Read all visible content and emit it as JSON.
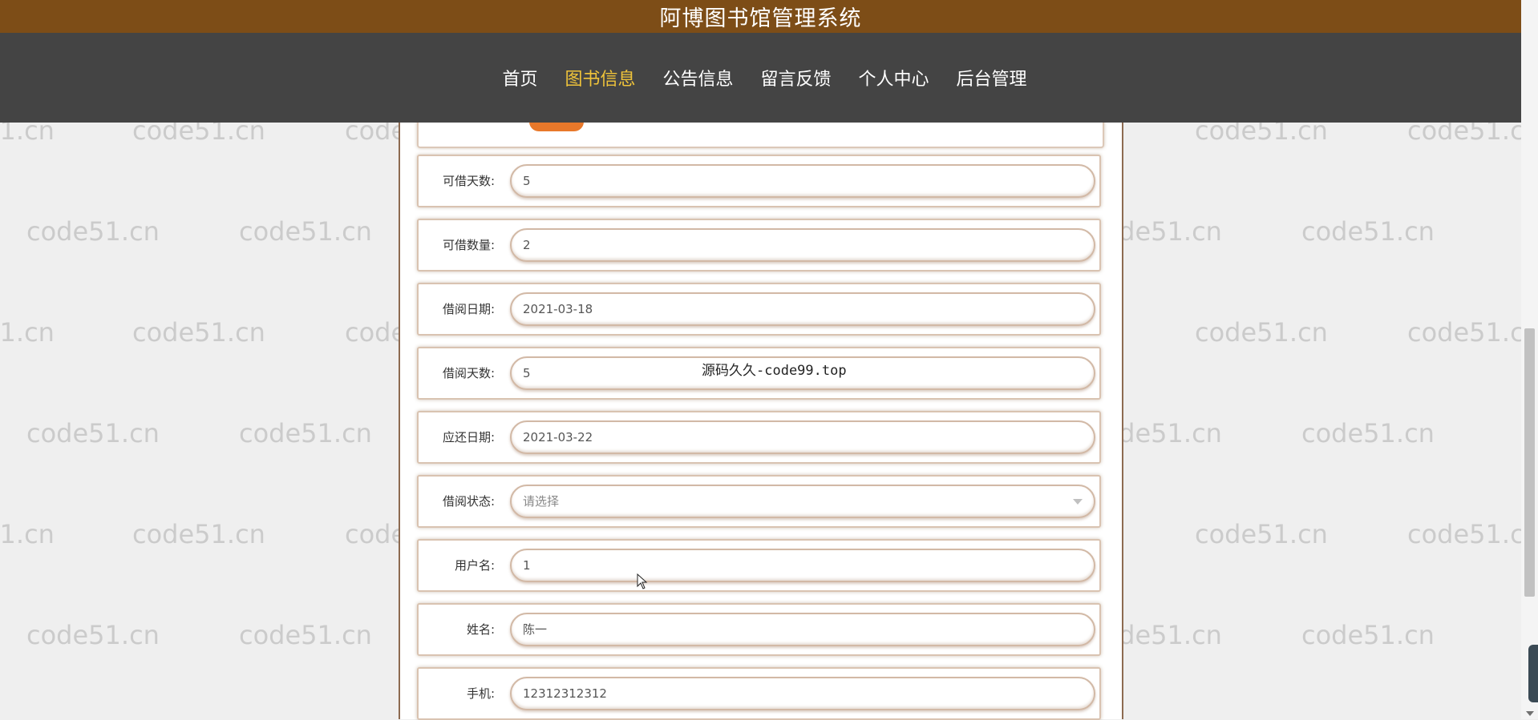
{
  "header": {
    "site_title": "阿博图书馆管理系统"
  },
  "nav": {
    "items": [
      "首页",
      "图书信息",
      "公告信息",
      "留言反馈",
      "个人中心",
      "后台管理"
    ],
    "active": "图书信息"
  },
  "form": {
    "fields": [
      {
        "label": "可借天数:",
        "value": "5"
      },
      {
        "label": "可借数量:",
        "value": "2"
      },
      {
        "label": "借阅日期:",
        "value": "2021-03-18"
      },
      {
        "label": "借阅天数:",
        "value": "5"
      },
      {
        "label": "应还日期:",
        "value": "2021-03-22"
      },
      {
        "label": "借阅状态:",
        "placeholder": "请选择"
      },
      {
        "label": "用户名:",
        "value": "1"
      },
      {
        "label": "姓名:",
        "value": "陈一"
      },
      {
        "label": "手机:",
        "value": "12312312312"
      }
    ]
  },
  "overlay": {
    "text": "源码久久-code99.top"
  },
  "watermark": {
    "text": "code51.cn"
  }
}
